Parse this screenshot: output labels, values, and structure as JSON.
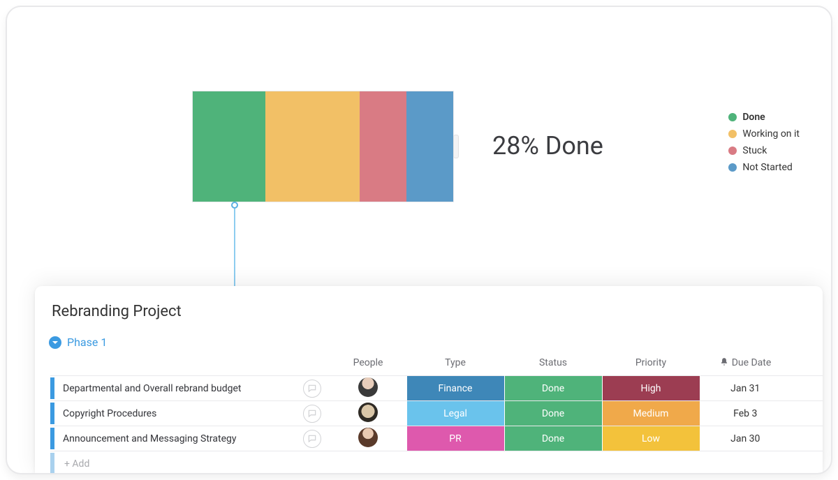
{
  "chart_data": {
    "type": "bar",
    "orientation": "horizontal-stacked",
    "title": "",
    "series": [
      {
        "name": "Done",
        "value": 28,
        "color": "#4fb37a"
      },
      {
        "name": "Working on it",
        "value": 36,
        "color": "#f2c066"
      },
      {
        "name": "Stuck",
        "value": 18,
        "color": "#d97b84"
      },
      {
        "name": "Not Started",
        "value": 18,
        "color": "#5b9ac8"
      }
    ],
    "summary_label": "28% Done"
  },
  "legend": [
    {
      "label": "Done",
      "color": "#4fb37a",
      "bold": true
    },
    {
      "label": "Working on it",
      "color": "#f2c066",
      "bold": false
    },
    {
      "label": "Stuck",
      "color": "#d97b84",
      "bold": false
    },
    {
      "label": "Not Started",
      "color": "#5b9ac8",
      "bold": false
    }
  ],
  "project": {
    "title": "Rebranding Project",
    "group_name": "Phase 1",
    "add_label": "+ Add",
    "columns": {
      "people": "People",
      "type": "Type",
      "status": "Status",
      "priority": "Priority",
      "due": "Due Date"
    },
    "rows": [
      {
        "task": "Departmental and Overall rebrand budget",
        "avatar": "av1",
        "type": {
          "label": "Finance",
          "color": "#3e87b8"
        },
        "status": {
          "label": "Done",
          "color": "#4fb37a"
        },
        "priority": {
          "label": "High",
          "color": "#9c3d52"
        },
        "due": "Jan 31"
      },
      {
        "task": "Copyright Procedures",
        "avatar": "av2",
        "type": {
          "label": "Legal",
          "color": "#6ac3ec"
        },
        "status": {
          "label": "Done",
          "color": "#4fb37a"
        },
        "priority": {
          "label": "Medium",
          "color": "#f0a94a"
        },
        "due": "Feb 3"
      },
      {
        "task": "Announcement and Messaging Strategy",
        "avatar": "av3",
        "type": {
          "label": "PR",
          "color": "#de59ad"
        },
        "status": {
          "label": "Done",
          "color": "#4fb37a"
        },
        "priority": {
          "label": "Low",
          "color": "#f3c23b"
        },
        "due": "Jan 30"
      }
    ]
  }
}
